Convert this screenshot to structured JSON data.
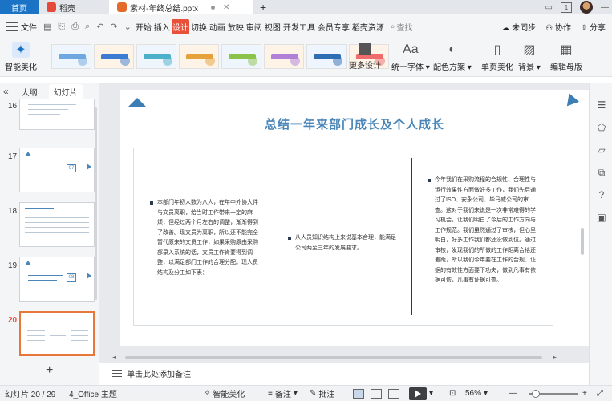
{
  "tabs": {
    "home": "首页",
    "doc": "稻壳",
    "file": "素材-年终总结.pptx",
    "win_badge": "1"
  },
  "menubar": {
    "file": "文件",
    "menus": [
      "开始",
      "插入",
      "设计",
      "切换",
      "动画",
      "放映",
      "审阅",
      "视图",
      "开发工具",
      "会员专享",
      "稻壳资源"
    ],
    "active_menu": "设计",
    "search": "查找",
    "right": [
      "未同步",
      "协作",
      "分享"
    ]
  },
  "ribbon": {
    "smart_beautify": "智能美化",
    "more_designs": "更多设计",
    "unify_font": "统一字体",
    "color_scheme": "配色方案",
    "single_page_beautify": "单页美化",
    "background": "背景",
    "edit_master": "编辑母版",
    "thumb_colors": [
      "#6fa7e0",
      "#3b7bd1",
      "#4bb0c9",
      "#e5a23a",
      "#8bc34a",
      "#b07fd6",
      "#2f6eb2",
      "#f06b6b"
    ]
  },
  "leftpanel": {
    "tab_outline": "大纲",
    "tab_slides": "幻灯片",
    "slides": [
      {
        "num": "16"
      },
      {
        "num": "17",
        "badge": "07"
      },
      {
        "num": "18"
      },
      {
        "num": "19",
        "badge": "08"
      },
      {
        "num": "20",
        "active": true
      }
    ]
  },
  "slide": {
    "title": "总结一年来部门成长及个人成长",
    "col1": "本部门年初人数为八人，在年中外协大件与文员离职，给当时工作带来一定的麻烦，但经过两个月左右的调整，渐渐得到了改善。现文员为离职，所以还不能完全暂代原来的文员工作，如果采购原由采购部录入系统的话，文员工作肯要得到调整，以满足部门工作的合理分配。现人员结构及分工如下表：",
    "col2": "从人员知识结构上来说基本合理，能满足公司两至三年的发展要求。",
    "col3": "今年我们在采购流程的合规性、合理性与运行效果性方面做好多工作，我们先后通过了ISO、安永公司、毕马威公司的审查。这对于我们来说是一次非常难得的学习机会，让我们明白了今后的工作方向与工作规范。我们虽然通过了审核，但心里明白，好多工作我们都还没做到位。通过审核，发现我们的所做的工作距离合格还差距，所以我们今年要在工作的合规、证据的有效性方面要下功夫，做到凡事有依据可依，凡事有证据可查。"
  },
  "notes": {
    "placeholder": "单击此处添加备注"
  },
  "statusbar": {
    "slide_counter": "幻灯片 20 / 29",
    "theme": "4_Office 主题",
    "smart_beautify": "智能美化",
    "notes": "备注",
    "comments": "批注",
    "zoom": "56%",
    "zoom_level": 0.56
  }
}
